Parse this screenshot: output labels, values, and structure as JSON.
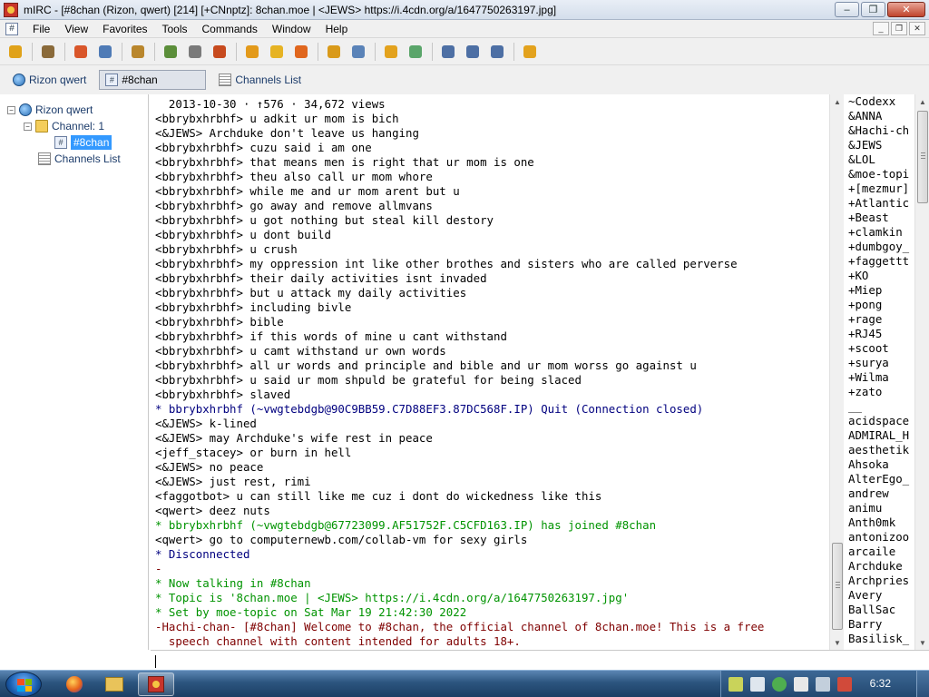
{
  "window": {
    "title": "mIRC - [#8chan (Rizon, qwert) [214] [+CNnptz]: 8chan.moe | <JEWS> https://i.4cdn.org/a/1647750263197.jpg]",
    "minimize": "–",
    "maximize": "❐",
    "close": "✕"
  },
  "menu": {
    "items": [
      "File",
      "View",
      "Favorites",
      "Tools",
      "Commands",
      "Window",
      "Help"
    ],
    "mdi_minimize": "_",
    "mdi_restore": "❐",
    "mdi_close": "✕"
  },
  "toolbar": {
    "icons": [
      {
        "name": "connect-icon",
        "color": "#e0a21a"
      },
      {
        "name": "sep"
      },
      {
        "name": "options-icon",
        "color": "#8a6a3a"
      },
      {
        "name": "sep"
      },
      {
        "name": "favorites-icon",
        "color": "#d9562a"
      },
      {
        "name": "address-book-icon",
        "color": "#4f7bb6"
      },
      {
        "name": "sep"
      },
      {
        "name": "channels-list-icon",
        "color": "#b9862c"
      },
      {
        "name": "sep"
      },
      {
        "name": "scripts-editor-icon",
        "color": "#5b8e3a"
      },
      {
        "name": "timer-icon",
        "color": "#7a7a7a"
      },
      {
        "name": "colors-icon",
        "color": "#c74a1e"
      },
      {
        "name": "sep"
      },
      {
        "name": "send-file-icon",
        "color": "#e39a1b"
      },
      {
        "name": "chat-icon",
        "color": "#e6b323"
      },
      {
        "name": "notify-list-icon",
        "color": "#e0661d"
      },
      {
        "name": "sep"
      },
      {
        "name": "url-catcher-icon",
        "color": "#d99a1a"
      },
      {
        "name": "dcc-icon",
        "color": "#5a83b8"
      },
      {
        "name": "sep"
      },
      {
        "name": "log-icon",
        "color": "#e3a21d"
      },
      {
        "name": "received-files-icon",
        "color": "#5aa56a"
      },
      {
        "name": "sep"
      },
      {
        "name": "tile-horizontal-icon",
        "color": "#4d6fa4"
      },
      {
        "name": "tile-vertical-icon",
        "color": "#4d6fa4"
      },
      {
        "name": "cascade-icon",
        "color": "#4d6fa4"
      },
      {
        "name": "sep"
      },
      {
        "name": "help-icon",
        "color": "#e3a21d"
      }
    ]
  },
  "switchbar": {
    "server": "Rizon qwert",
    "channel": "#8chan",
    "channel_glyph": "#",
    "list": "Channels List"
  },
  "tree": {
    "server": "Rizon qwert",
    "folder": "Channel: 1",
    "channel": "#8chan",
    "channel_glyph": "#",
    "list": "Channels List",
    "expander_minus": "−"
  },
  "chat": {
    "lines": [
      {
        "text": "  2013-10-30 · ↑576 · 34,672 views",
        "style": "black"
      },
      {
        "text": "<bbrybxhrbhf> u adkit ur mom is bich",
        "style": "black"
      },
      {
        "text": "<&JEWS> Archduke don't leave us hanging",
        "style": "black"
      },
      {
        "text": "<bbrybxhrbhf> cuzu said i am one",
        "style": "black"
      },
      {
        "text": "<bbrybxhrbhf> that means men is right that ur mom is one",
        "style": "black"
      },
      {
        "text": "<bbrybxhrbhf> theu also call ur mom whore",
        "style": "black"
      },
      {
        "text": "<bbrybxhrbhf> while me and ur mom arent but u",
        "style": "black"
      },
      {
        "text": "<bbrybxhrbhf> go away and remove allmvans",
        "style": "black"
      },
      {
        "text": "<bbrybxhrbhf> u got nothing but steal kill destory",
        "style": "black"
      },
      {
        "text": "<bbrybxhrbhf> u dont build",
        "style": "black"
      },
      {
        "text": "<bbrybxhrbhf> u crush",
        "style": "black"
      },
      {
        "text": "<bbrybxhrbhf> my oppression int like other brothes and sisters who are called perverse",
        "style": "black"
      },
      {
        "text": "<bbrybxhrbhf> their daily activities isnt invaded",
        "style": "black"
      },
      {
        "text": "<bbrybxhrbhf> but u attack my daily activities",
        "style": "black"
      },
      {
        "text": "<bbrybxhrbhf> including bivle",
        "style": "black"
      },
      {
        "text": "<bbrybxhrbhf> bible",
        "style": "black"
      },
      {
        "text": "<bbrybxhrbhf> if this words of mine u cant withstand",
        "style": "black"
      },
      {
        "text": "<bbrybxhrbhf> u camt withstand ur own words",
        "style": "black"
      },
      {
        "text": "<bbrybxhrbhf> all ur words and principle and bible and ur mom worss go against u",
        "style": "black"
      },
      {
        "text": "<bbrybxhrbhf> u said ur mom shpuld be grateful for being slaced",
        "style": "black"
      },
      {
        "text": "<bbrybxhrbhf> slaved",
        "style": "black"
      },
      {
        "text": "* bbrybxhrbhf (~vwgtebdgb@90C9BB59.C7D88EF3.87DC568F.IP) Quit (Connection closed)",
        "style": "navy"
      },
      {
        "text": "<&JEWS> k-lined",
        "style": "black"
      },
      {
        "text": "<&JEWS> may Archduke's wife rest in peace",
        "style": "black"
      },
      {
        "text": "<jeff_stacey> or burn in hell",
        "style": "black"
      },
      {
        "text": "<&JEWS> no peace",
        "style": "black"
      },
      {
        "text": "<&JEWS> just rest, rimi",
        "style": "black"
      },
      {
        "text": "<faggotbot> u can still like me cuz i dont do wickedness like this",
        "style": "black"
      },
      {
        "text": "<qwert> deez nuts",
        "style": "black"
      },
      {
        "text": "* bbrybxhrbhf (~vwgtebdgb@67723099.AF51752F.C5CFD163.IP) has joined #8chan",
        "style": "green"
      },
      {
        "text": "<qwert> go to computernewb.com/collab-vm for sexy girls",
        "style": "black"
      },
      {
        "text": "* Disconnected",
        "style": "navy"
      },
      {
        "text": "-",
        "style": "red"
      },
      {
        "text": "* Now talking in #8chan",
        "style": "green"
      },
      {
        "text": "* Topic is '8chan.moe | <JEWS> https://i.4cdn.org/a/1647750263197.jpg'",
        "style": "green"
      },
      {
        "text": "* Set by moe-topic on Sat Mar 19 21:42:30 2022",
        "style": "green"
      },
      {
        "text": "-Hachi-chan- [#8chan] Welcome to #8chan, the official channel of 8chan.moe! This is a free",
        "style": "red"
      },
      {
        "text": "  speech channel with content intended for adults 18+.",
        "style": "red"
      }
    ]
  },
  "nicklist": {
    "nicks": [
      "~Codexx",
      "&ANNA",
      "&Hachi-ch",
      "&JEWS",
      "&LOL",
      "&moe-topi",
      "+[mezmur]",
      "+Atlantic",
      "+Beast",
      "+clamkin",
      "+dumbgoy_",
      "+faggettt",
      "+KO",
      "+Miep",
      "+pong",
      "+rage",
      "+RJ45",
      "+scoot",
      "+surya",
      "+Wilma",
      "+zato",
      "__",
      "acidspace",
      "ADMIRAL_H",
      "aesthetik",
      "Ahsoka",
      "AlterEgo_",
      "andrew",
      "animu",
      "Anth0mk",
      "antonizoo",
      "arcaile",
      "Archduke",
      "Archpries",
      "Avery",
      "BallSac",
      "Barry",
      "Basilisk_"
    ]
  },
  "editbox": {
    "value": ""
  },
  "taskbar": {
    "clock": "6:32"
  },
  "colors": {
    "green": "#009300",
    "navy": "#00007f",
    "red": "#7f0000"
  }
}
